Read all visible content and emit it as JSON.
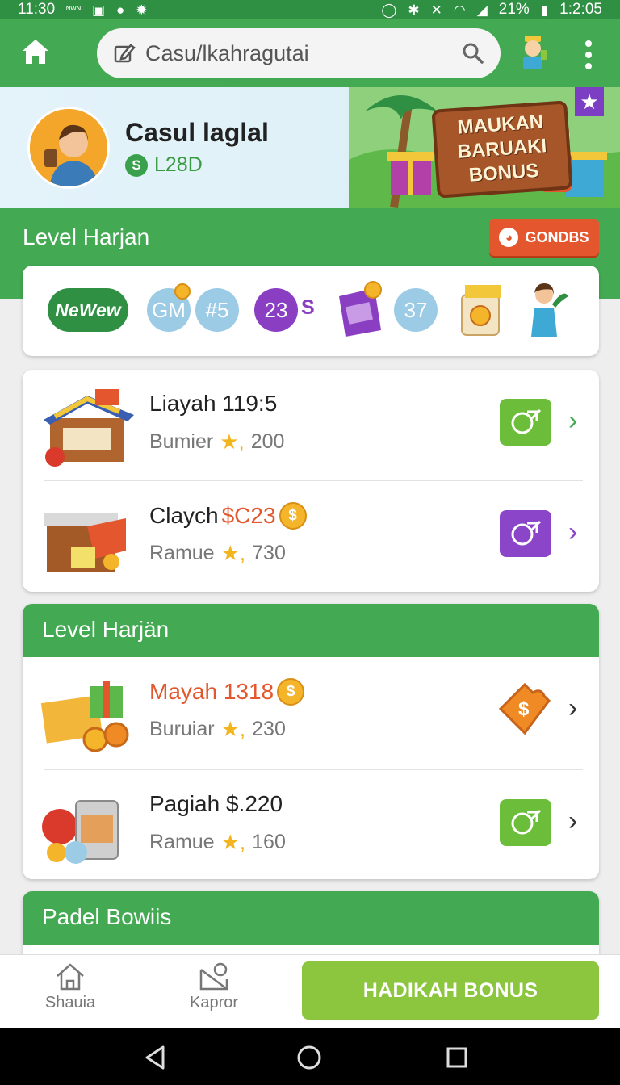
{
  "status_bar": {
    "time_left": "11:30",
    "network_label": "ᴺᵂᴺ",
    "battery": "21%",
    "time_right": "1:2:05"
  },
  "app_bar": {
    "url": "Casu/lkahragutai"
  },
  "profile": {
    "name": "Casul laglal",
    "coin_symbol": "S",
    "balance": "L28D",
    "banner_sign_lines": [
      "MAUKAN",
      "BARUAKI",
      "BONUS"
    ]
  },
  "section_level": {
    "title": "Level Harjan",
    "button_label": "GONDBS"
  },
  "chips": {
    "new_label": "NeWew",
    "c1": "GM",
    "c2": "#5",
    "c3": "23",
    "c3_suffix": "S",
    "c4": "37"
  },
  "list_one": [
    {
      "title": "Liayah 119:5",
      "subtitle": "Bumier",
      "rating": "200",
      "action_color": "#6bbd3a"
    },
    {
      "title": "Claych",
      "title_accent": "$C23",
      "subtitle": "Ramue",
      "rating": "730",
      "action_color": "#8a45c8"
    }
  ],
  "card_two": {
    "header": "Level Harjän",
    "rows": [
      {
        "title": "Mayah 1318",
        "subtitle": "Buruiar",
        "rating": "230"
      },
      {
        "title": "Pagiah $.220",
        "subtitle": "Ramue",
        "rating": "160"
      }
    ]
  },
  "card_three": {
    "header": "Padel Bowiis"
  },
  "bottom_nav": {
    "item1": "Shauia",
    "item2": "Kapror",
    "cta": "HADIKAH BONUS"
  },
  "colors": {
    "primary_green": "#43a953",
    "accent_orange": "#e4572e",
    "accent_purple": "#8a45c8",
    "cta_green": "#8cc63f"
  },
  "icons": [
    "home-icon",
    "edit-icon",
    "search-icon",
    "more-vert-icon",
    "star-icon",
    "coin-icon",
    "chevron-right-icon",
    "back-icon",
    "home-circle-icon",
    "recents-icon"
  ]
}
